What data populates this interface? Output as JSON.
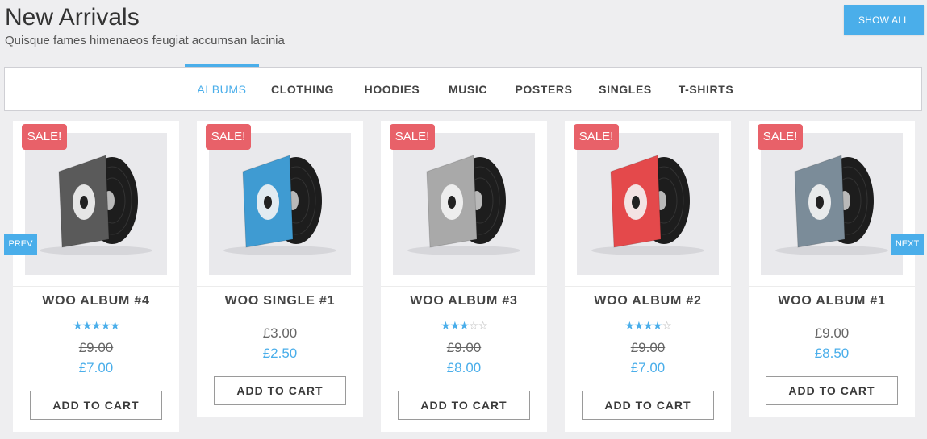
{
  "header": {
    "title": "New Arrivals",
    "subtitle": "Quisque fames himenaeos feugiat accumsan lacinia",
    "show_all": "SHOW ALL"
  },
  "tabs": [
    {
      "label": "ALBUMS",
      "active": true
    },
    {
      "label": "CLOTHING",
      "active": false
    },
    {
      "label": "HOODIES",
      "active": false
    },
    {
      "label": "MUSIC",
      "active": false
    },
    {
      "label": "POSTERS",
      "active": false
    },
    {
      "label": "SINGLES",
      "active": false
    },
    {
      "label": "T-SHIRTS",
      "active": false
    }
  ],
  "carousel": {
    "prev": "PREV",
    "next": "NEXT"
  },
  "products": [
    {
      "name": "WOO ALBUM #4",
      "badge": "SALE!",
      "rating": 5,
      "old_price": "£9.00",
      "price": "£7.00",
      "button": "ADD TO CART",
      "sleeve_color": "#5a5a5a"
    },
    {
      "name": "WOO SINGLE #1",
      "badge": "SALE!",
      "rating": 0,
      "old_price": "£3.00",
      "price": "£2.50",
      "button": "ADD TO CART",
      "sleeve_color": "#3f9bd2"
    },
    {
      "name": "WOO ALBUM #3",
      "badge": "SALE!",
      "rating": 3,
      "old_price": "£9.00",
      "price": "£8.00",
      "button": "ADD TO CART",
      "sleeve_color": "#a9a9a9"
    },
    {
      "name": "WOO ALBUM #2",
      "badge": "SALE!",
      "rating": 4,
      "old_price": "£9.00",
      "price": "£7.00",
      "button": "ADD TO CART",
      "sleeve_color": "#e4494b"
    },
    {
      "name": "WOO ALBUM #1",
      "badge": "SALE!",
      "rating": 0,
      "old_price": "£9.00",
      "price": "£8.50",
      "button": "ADD TO CART",
      "sleeve_color": "#7b8c99"
    }
  ],
  "colors": {
    "accent": "#4aaeea",
    "sale": "#e86169",
    "background": "#eeeef0"
  }
}
